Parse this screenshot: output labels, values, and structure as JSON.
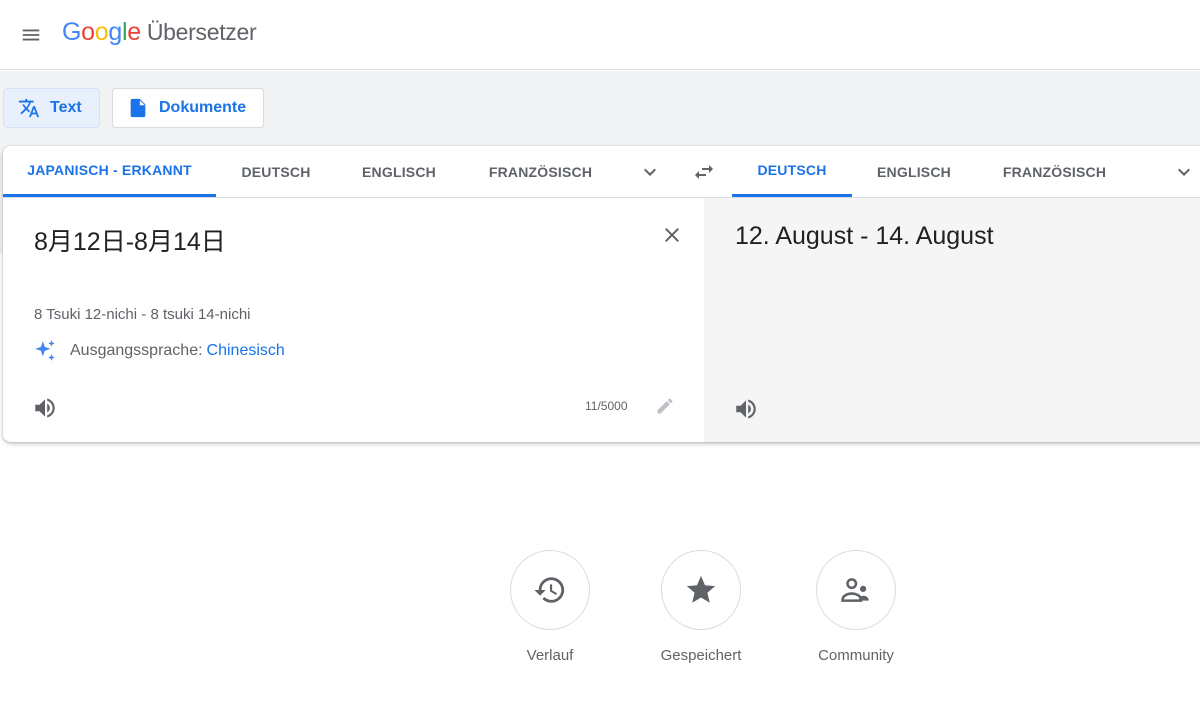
{
  "header": {
    "logo_letters": [
      "G",
      "o",
      "o",
      "g",
      "l",
      "e"
    ],
    "product_name": "Übersetzer",
    "icons": [
      "menu-icon"
    ]
  },
  "modes": [
    {
      "label": "Text",
      "icon": "translate-icon",
      "selected": true
    },
    {
      "label": "Dokumente",
      "icon": "document-icon",
      "selected": false
    }
  ],
  "source_languages": [
    {
      "label": "JAPANISCH - ERKANNT",
      "active": true
    },
    {
      "label": "DEUTSCH",
      "active": false
    },
    {
      "label": "ENGLISCH",
      "active": false
    },
    {
      "label": "FRANZÖSISCH",
      "active": false
    }
  ],
  "target_languages": [
    {
      "label": "DEUTSCH",
      "active": true
    },
    {
      "label": "ENGLISCH",
      "active": false
    },
    {
      "label": "FRANZÖSISCH",
      "active": false
    }
  ],
  "source": {
    "text": "8月12日-8月14日",
    "transliteration": "8 Tsuki 12-nichi - 8 tsuki 14-nichi",
    "detected_prefix": "Ausgangssprache:",
    "detected_language": "Chinesisch",
    "char_count": "11/5000"
  },
  "target": {
    "text": "12. August - 14. August"
  },
  "quick_actions": [
    {
      "label": "Verlauf",
      "icon": "history-icon"
    },
    {
      "label": "Gespeichert",
      "icon": "star-icon"
    },
    {
      "label": "Community",
      "icon": "community-icon"
    }
  ],
  "colors": {
    "accent": "#1a73e8",
    "text_secondary": "#5f6368",
    "band_bg": "#f1f3f4",
    "target_pane_bg": "#f5f5f5"
  }
}
